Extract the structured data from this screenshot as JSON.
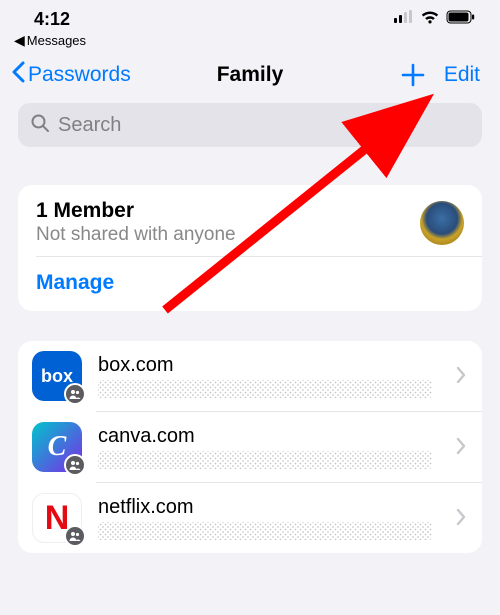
{
  "status": {
    "time": "4:12",
    "breadcrumb_app": "Messages"
  },
  "nav": {
    "back_label": "Passwords",
    "title": "Family",
    "edit_label": "Edit"
  },
  "search": {
    "placeholder": "Search"
  },
  "group": {
    "member_count_label": "1 Member",
    "sharing_status": "Not shared with anyone",
    "manage_label": "Manage"
  },
  "entries": [
    {
      "domain": "box.com",
      "icon_text": "box",
      "icon_class": "box"
    },
    {
      "domain": "canva.com",
      "icon_text": "C",
      "icon_class": "canva"
    },
    {
      "domain": "netflix.com",
      "icon_text": "N",
      "icon_class": "netflix"
    }
  ]
}
